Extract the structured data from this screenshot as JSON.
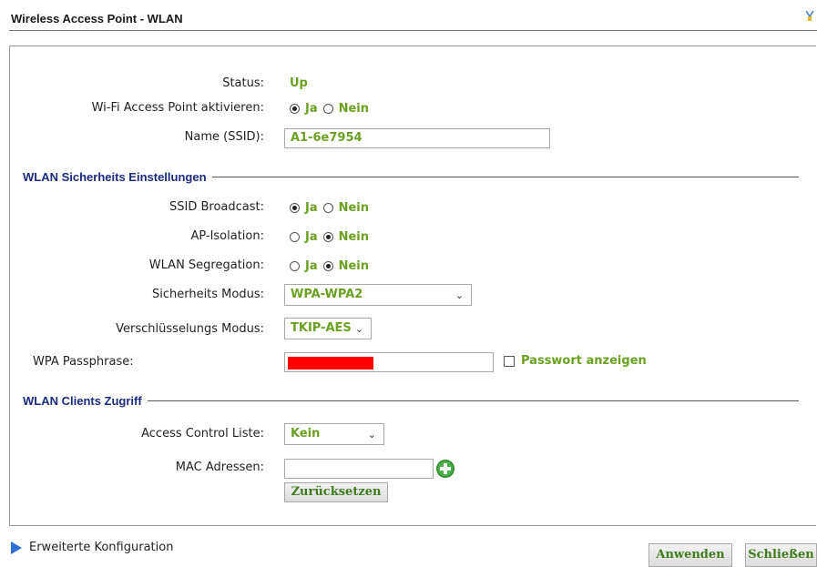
{
  "header": {
    "title": "Wireless Access Point - WLAN"
  },
  "status": {
    "label": "Status:",
    "value": "Up"
  },
  "wifi_enable": {
    "label": "Wi-Fi Access Point aktivieren:",
    "yes": "Ja",
    "no": "Nein",
    "selected": "yes"
  },
  "ssid": {
    "label": "Name (SSID):",
    "value": "A1-6e7954"
  },
  "security_section": {
    "title": "WLAN Sicherheits Einstellungen"
  },
  "ssid_broadcast": {
    "label": "SSID Broadcast:",
    "yes": "Ja",
    "no": "Nein",
    "selected": "yes"
  },
  "ap_isolation": {
    "label": "AP-Isolation:",
    "yes": "Ja",
    "no": "Nein",
    "selected": "no"
  },
  "wlan_segregation": {
    "label": "WLAN Segregation:",
    "yes": "Ja",
    "no": "Nein",
    "selected": "no"
  },
  "security_mode": {
    "label": "Sicherheits Modus:",
    "value": "WPA-WPA2"
  },
  "encryption_mode": {
    "label": "Verschlüsselungs Modus:",
    "value": "TKIP-AES"
  },
  "passphrase": {
    "label": "WPA Passphrase:",
    "show_label": "Passwort anzeigen",
    "show_checked": false
  },
  "clients_section": {
    "title": "WLAN Clients Zugriff"
  },
  "acl": {
    "label": "Access Control Liste:",
    "value": "Kein"
  },
  "mac": {
    "label": "MAC Adressen:",
    "value": "",
    "reset_label": "Zurücksetzen"
  },
  "footer": {
    "advanced_label": "Erweiterte Konfiguration",
    "apply_label": "Anwenden",
    "close_label": "Schließen"
  },
  "colors": {
    "value_green": "#6aa120",
    "section_blue": "#1a2b80",
    "link_arrow": "#2f6fd6",
    "redaction": "#ff0000"
  },
  "icons": {
    "add": "plus-circle-icon",
    "advanced": "triangle-right-icon",
    "corner": "network-icon"
  }
}
